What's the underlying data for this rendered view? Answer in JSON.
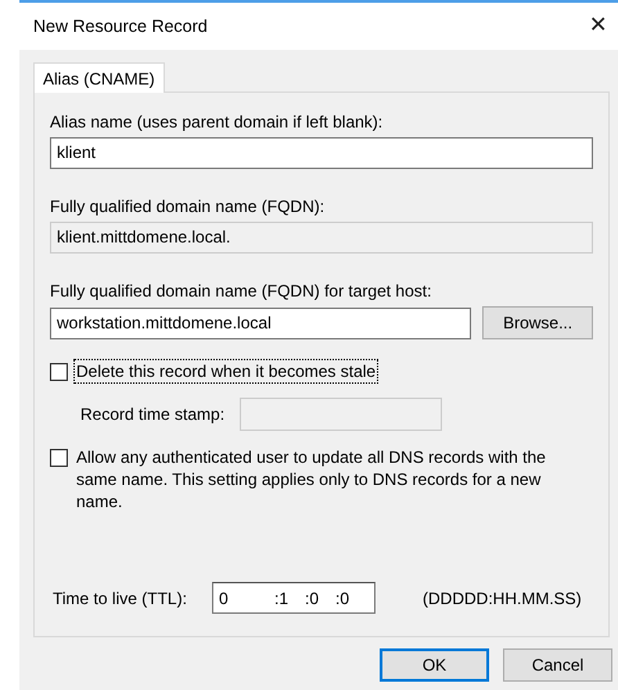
{
  "window": {
    "title": "New Resource Record",
    "close": "✕"
  },
  "tabs": [
    {
      "label": "Alias (CNAME)",
      "selected": true
    }
  ],
  "alias_name": {
    "label": "Alias name (uses parent domain if left blank):",
    "value": "klient",
    "disabled": false
  },
  "fqdn": {
    "label": "Fully qualified domain name (FQDN):",
    "value": "klient.mittdomene.local.",
    "disabled": true
  },
  "target_host": {
    "label": "Fully qualified domain name (FQDN) for target host:",
    "value": "workstation.mittdomene.local",
    "disabled": false,
    "browse_button": "Browse..."
  },
  "delete_stale": {
    "label": "Delete this record when it becomes stale",
    "checked": false,
    "focused": true
  },
  "record_time_stamp": {
    "label": "Record time stamp:",
    "disabled": true
  },
  "allow_update": {
    "label": "Allow any authenticated user to update all DNS records with the same name. This setting applies only to DNS records for a new name.",
    "checked": false,
    "focused": false
  },
  "ttl": {
    "label": "Time to live (TTL):",
    "segments": [
      "0",
      ":1",
      ":0",
      ":0"
    ],
    "format": "(DDDDD:HH.MM.SS)"
  },
  "buttons": [
    {
      "label": "OK",
      "default": true
    },
    {
      "label": "Cancel",
      "default": false
    }
  ]
}
